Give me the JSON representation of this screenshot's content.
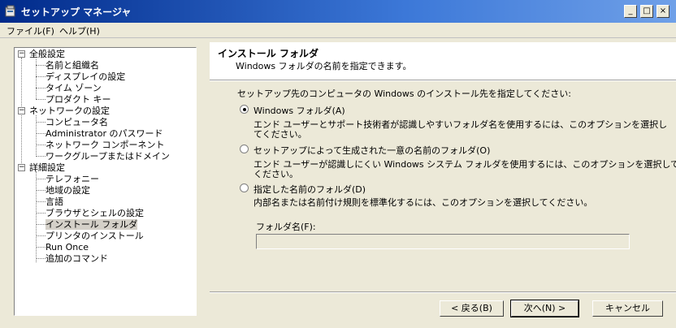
{
  "window": {
    "title": "セットアップ マネージャ"
  },
  "menu": {
    "items": [
      "ファイル(F)",
      "ヘルプ(H)"
    ]
  },
  "tree": {
    "groups": [
      {
        "label": "全般設定",
        "items": [
          "名前と組織名",
          "ディスプレイの設定",
          "タイム ゾーン",
          "プロダクト キー"
        ]
      },
      {
        "label": "ネットワークの設定",
        "items": [
          "コンピュータ名",
          "Administrator のパスワード",
          "ネットワーク コンポーネント",
          "ワークグループまたはドメイン"
        ]
      },
      {
        "label": "詳細設定",
        "items": [
          "テレフォニー",
          "地域の設定",
          "言語",
          "ブラウザとシェルの設定",
          "インストール フォルダ",
          "プリンタのインストール",
          "Run Once",
          "追加のコマンド"
        ]
      }
    ],
    "selected": "インストール フォルダ"
  },
  "header": {
    "title": "インストール フォルダ",
    "subtitle": "Windows フォルダの名前を指定できます。"
  },
  "main": {
    "prompt": "セットアップ先のコンピュータの Windows のインストール先を指定してください:",
    "options": [
      {
        "label": "Windows フォルダ(A)",
        "selected": true,
        "desc1": "エンド ユーザーとサポート技術者が認識しやすいフォルダ名を使用するには、このオプションを選択し",
        "desc2": "てください。"
      },
      {
        "label": "セットアップによって生成された一意の名前のフォルダ(O)",
        "selected": false,
        "desc1": "エンド ユーザーが認識しにくい Windows システム フォルダを使用するには、このオプションを選択して",
        "desc2": "ください。"
      },
      {
        "label": "指定した名前のフォルダ(D)",
        "selected": false,
        "desc1": "内部名または名前付け規則を標準化するには、このオプションを選択してください。",
        "desc2": ""
      }
    ],
    "folder_label": "フォルダ名(F):",
    "folder_value": ""
  },
  "buttons": {
    "back": "< 戻る(B)",
    "next": "次へ(N) >",
    "cancel": "キャンセル"
  },
  "colors": {
    "titlebar": "#0a246a",
    "face": "#ece9d8"
  }
}
